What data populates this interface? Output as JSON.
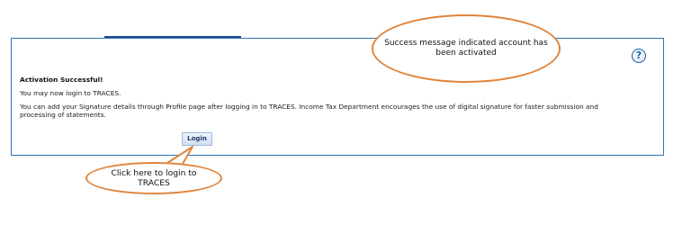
{
  "panel": {
    "title": "Activation Successful!",
    "line1": "You may now login to TRACES.",
    "line2": "You can add your Signature details through Profile page after logging in to TRACES. Income Tax Department encourages the use of digital signature for faster submission and processing of statements.",
    "login_label": "Login",
    "help_icon": "question-mark-icon",
    "help_glyph": "?"
  },
  "callouts": {
    "success": "Success message indicated account has been activated",
    "login": "Click here to login to TRACES"
  },
  "colors": {
    "panel_border": "#2e74b5",
    "callout_border": "#e0843b",
    "tab_strip": "#1f4e8c"
  }
}
